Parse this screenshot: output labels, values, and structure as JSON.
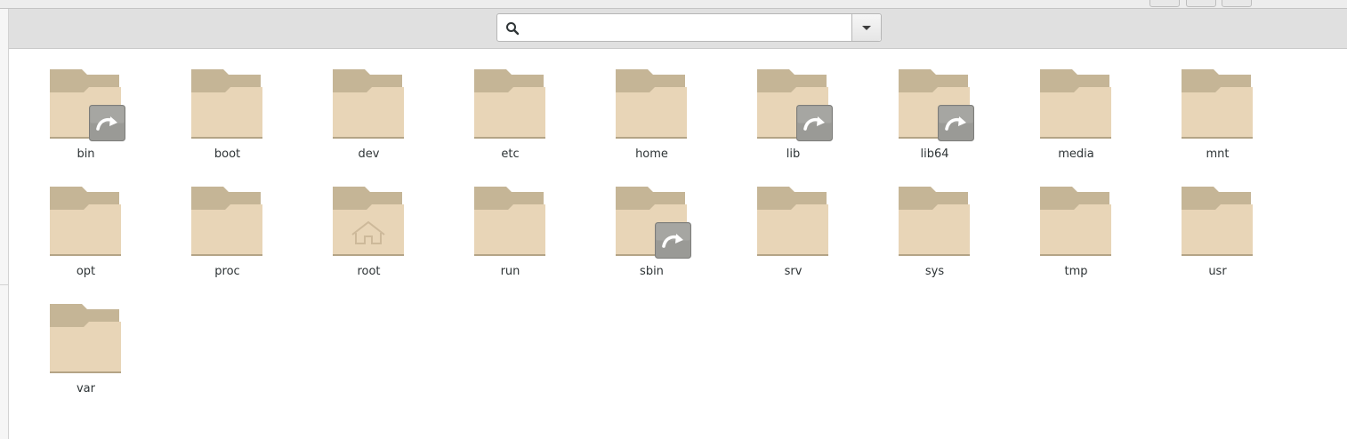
{
  "search": {
    "placeholder": "",
    "value": ""
  },
  "icons": {
    "search": "search-icon",
    "dropdown": "chevron-down-icon",
    "folder": "folder-icon",
    "symlink": "symlink-arrow-icon",
    "home": "home-icon"
  },
  "colors": {
    "folder_back": "#c5b596",
    "folder_front": "#e8d5b7",
    "badge": "#9a9a96",
    "toolbar": "#e0e0e0"
  },
  "files": [
    {
      "name": "bin",
      "symlink": true,
      "home": false
    },
    {
      "name": "boot",
      "symlink": false,
      "home": false
    },
    {
      "name": "dev",
      "symlink": false,
      "home": false
    },
    {
      "name": "etc",
      "symlink": false,
      "home": false
    },
    {
      "name": "home",
      "symlink": false,
      "home": false
    },
    {
      "name": "lib",
      "symlink": true,
      "home": false
    },
    {
      "name": "lib64",
      "symlink": true,
      "home": false
    },
    {
      "name": "media",
      "symlink": false,
      "home": false
    },
    {
      "name": "mnt",
      "symlink": false,
      "home": false
    },
    {
      "name": "opt",
      "symlink": false,
      "home": false
    },
    {
      "name": "proc",
      "symlink": false,
      "home": false
    },
    {
      "name": "root",
      "symlink": false,
      "home": true
    },
    {
      "name": "run",
      "symlink": false,
      "home": false
    },
    {
      "name": "sbin",
      "symlink": true,
      "home": false
    },
    {
      "name": "srv",
      "symlink": false,
      "home": false
    },
    {
      "name": "sys",
      "symlink": false,
      "home": false
    },
    {
      "name": "tmp",
      "symlink": false,
      "home": false
    },
    {
      "name": "usr",
      "symlink": false,
      "home": false
    },
    {
      "name": "var",
      "symlink": false,
      "home": false
    }
  ]
}
